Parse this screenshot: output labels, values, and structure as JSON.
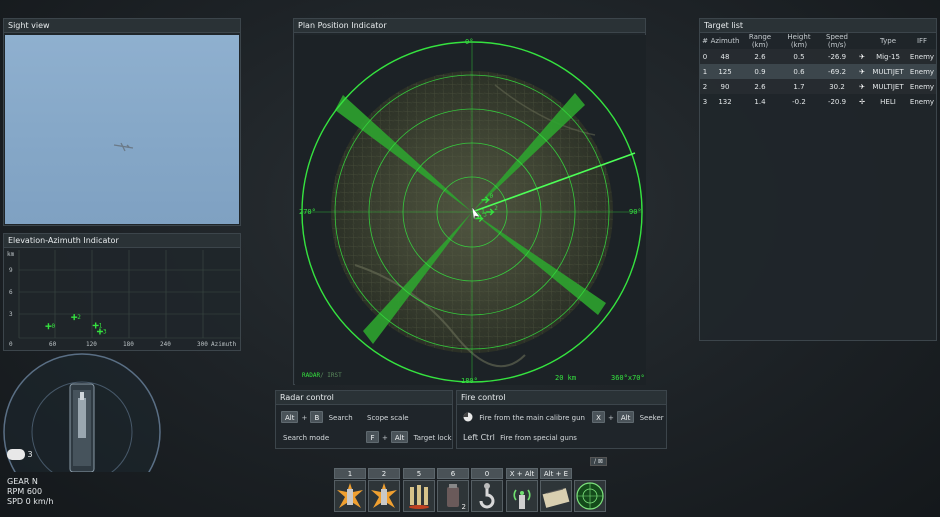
{
  "sight": {
    "title": "Sight view"
  },
  "elev": {
    "title": "Elevation-Azimuth Indicator",
    "y_unit": "km",
    "y_ticks": [
      "9",
      "6",
      "3",
      "0"
    ],
    "x_ticks": [
      "0",
      "60",
      "120",
      "180",
      "240",
      "300"
    ],
    "x_label": "Azimuth",
    "targets": [
      {
        "id": "0",
        "az": 48,
        "h": 0.5
      },
      {
        "id": "2",
        "az": 90,
        "h": 1.7
      },
      {
        "id": "1",
        "az": 125,
        "h": 0.6
      },
      {
        "id": "3",
        "az": 132,
        "h": -0.2
      }
    ]
  },
  "ppi": {
    "title": "Plan Position Indicator",
    "north": "0°",
    "east": "90°",
    "south": "180°",
    "west": "270°",
    "mode_label": "RADAR",
    "mode_sub": "/ IRST",
    "range": "20 km",
    "scan": "360°x70°",
    "targets": [
      {
        "id": "0",
        "az": 48,
        "range": 2.6
      },
      {
        "id": "1",
        "az": 125,
        "range": 0.9
      },
      {
        "id": "2",
        "az": 90,
        "range": 2.6
      },
      {
        "id": "3",
        "az": 132,
        "range": 1.4
      }
    ]
  },
  "target_list": {
    "title": "Target list",
    "headers": [
      "#",
      "Azimuth",
      "Range (km)",
      "Height (km)",
      "Speed (m/s)",
      "",
      "Type",
      "IFF"
    ],
    "rows": [
      [
        "0",
        "48",
        "2.6",
        "0.5",
        "-26.9",
        "✈",
        "Mig-15",
        "Enemy"
      ],
      [
        "1",
        "125",
        "0.9",
        "0.6",
        "-69.2",
        "✈",
        "MULTIJET",
        "Enemy"
      ],
      [
        "2",
        "90",
        "2.6",
        "1.7",
        "30.2",
        "✈",
        "MULTIJET",
        "Enemy"
      ],
      [
        "3",
        "132",
        "1.4",
        "-0.2",
        "-20.9",
        "✢",
        "HELI",
        "Enemy"
      ]
    ],
    "selected_row": 1
  },
  "radar_control": {
    "title": "Radar control",
    "search_keys": [
      "Alt",
      "B"
    ],
    "search_label": "Search",
    "scope_label": "Scope scale",
    "mode_label": "Search mode",
    "lock_keys": [
      "F",
      "Alt"
    ],
    "lock_label": "Target lock"
  },
  "fire_control": {
    "title": "Fire control",
    "main_label": "Fire from the main calibre gun",
    "seeker_keys": [
      "X",
      "Alt"
    ],
    "seeker_label": "Seeker",
    "special_key": "Left Ctrl",
    "special_label": "Fire from special guns"
  },
  "vehicle": {
    "crew_count": "3",
    "gear": "GEAR N",
    "rpm": "RPM 600",
    "spd": "SPD 0 km/h"
  },
  "ammo_bar": {
    "small_key": "/ ⊠",
    "slots": [
      {
        "key": "1",
        "icon": "shell-burst-icon",
        "count": ""
      },
      {
        "key": "2",
        "icon": "shell-burst-icon",
        "count": ""
      },
      {
        "key": "5",
        "icon": "artillery-icon",
        "count": ""
      },
      {
        "key": "6",
        "icon": "smoke-grenade-icon",
        "count": "2"
      },
      {
        "key": "0",
        "icon": "hook-icon",
        "count": ""
      },
      {
        "key": "X + Alt",
        "icon": "radio-icon",
        "count": ""
      },
      {
        "key": "Alt + E",
        "icon": "toolbox-icon",
        "count": ""
      },
      {
        "key": "",
        "icon": "radar-scope-icon",
        "count": ""
      }
    ]
  },
  "colors": {
    "radar_green": "#35e23f",
    "panel_bg": "#20262a",
    "sky": "#8aabcb"
  }
}
